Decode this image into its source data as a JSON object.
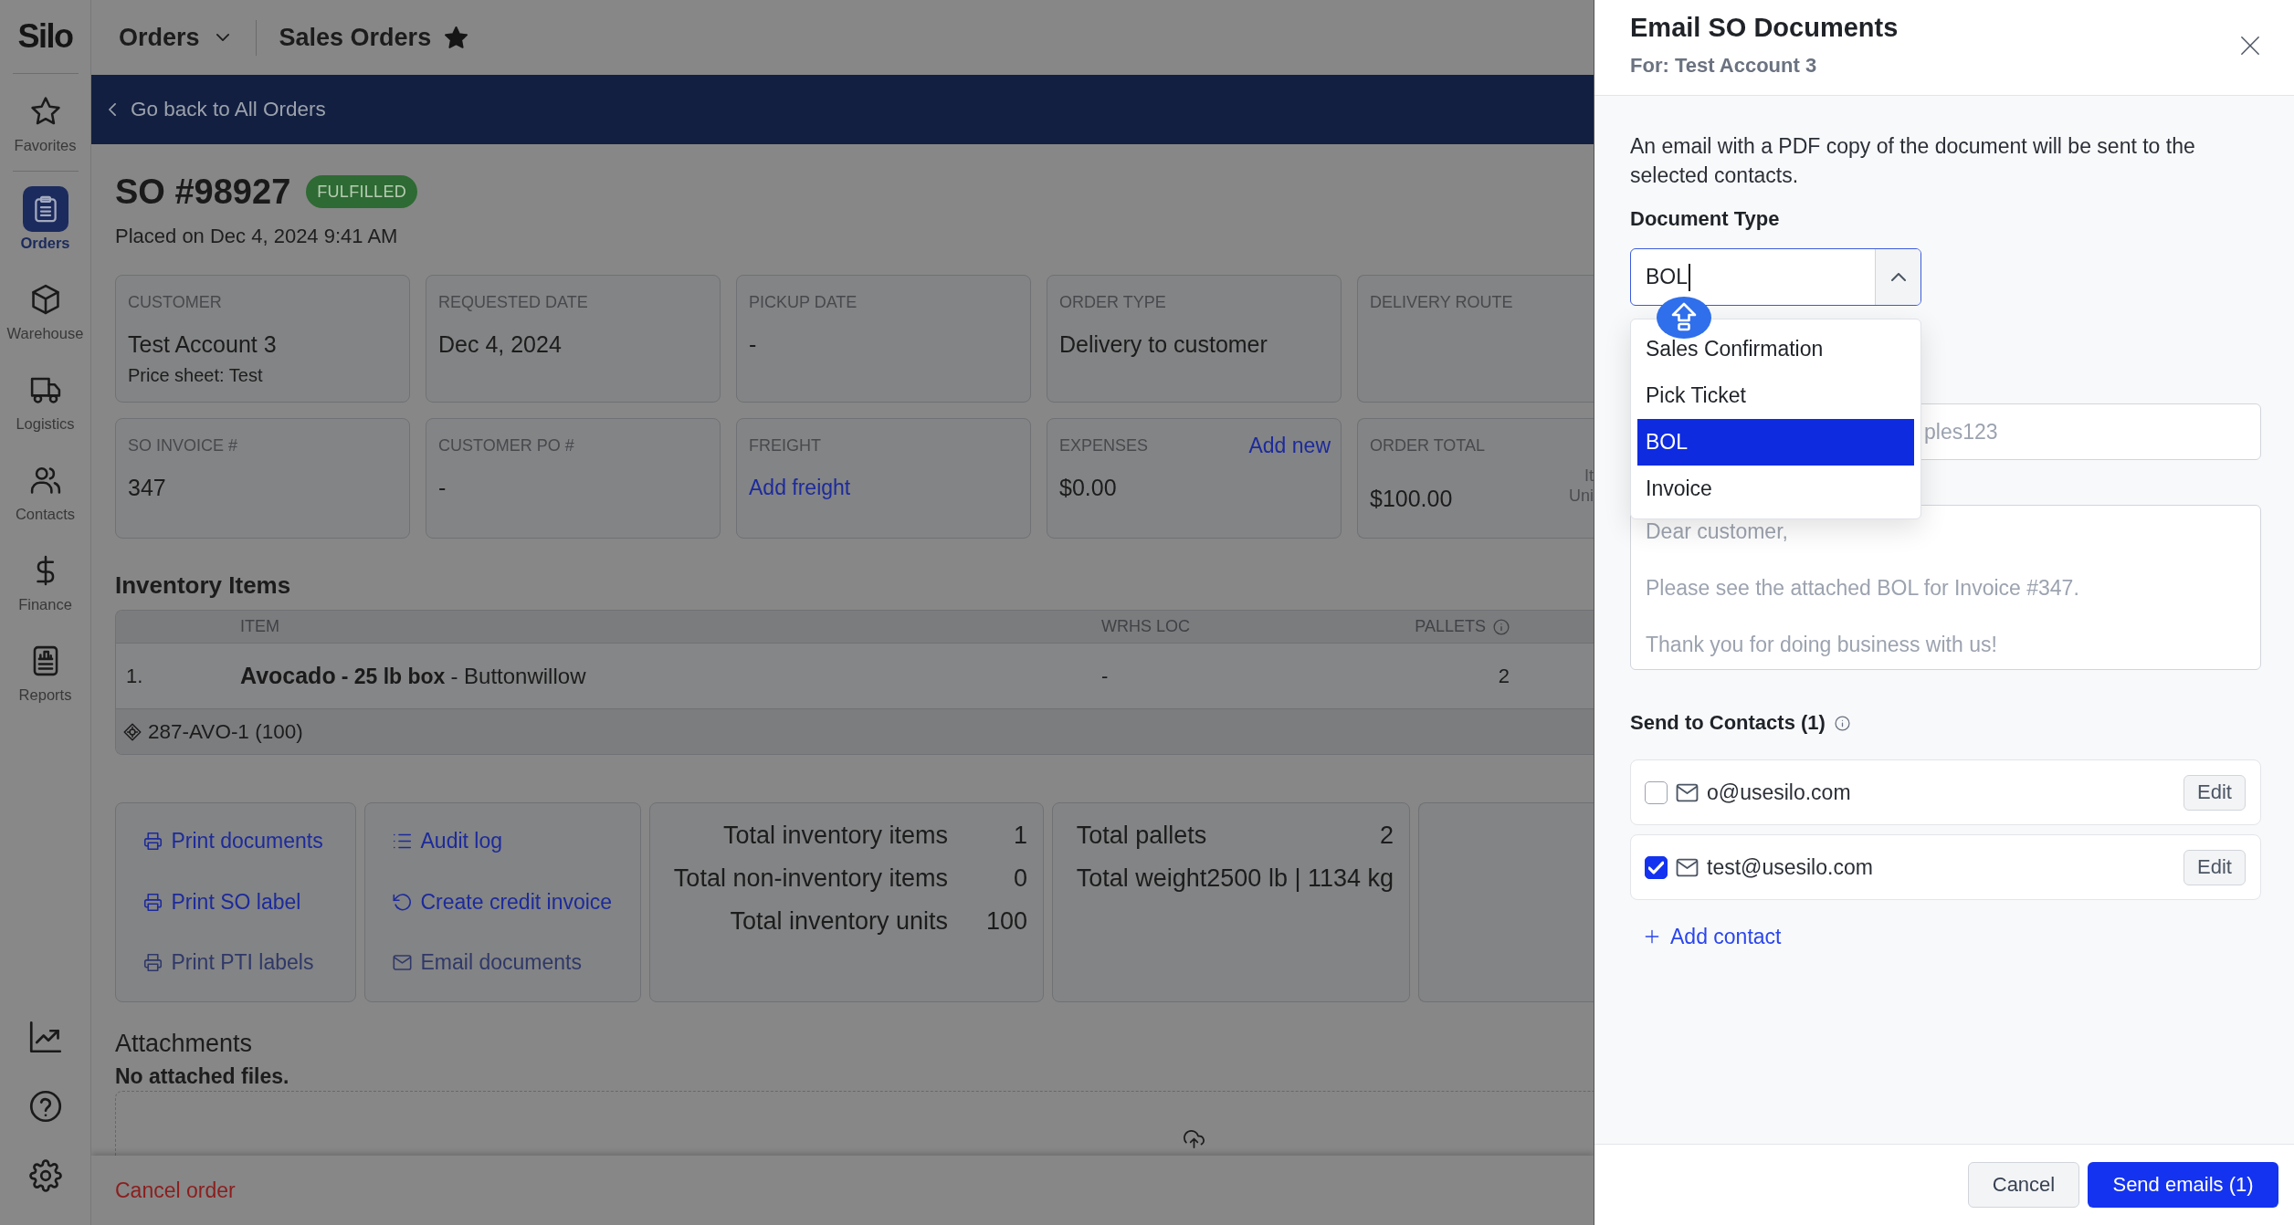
{
  "sidebar": {
    "logo": "Silo",
    "items": [
      {
        "label": "Favorites",
        "selected": false
      },
      {
        "label": "Orders",
        "selected": true
      },
      {
        "label": "Warehouse",
        "selected": false
      },
      {
        "label": "Logistics",
        "selected": false
      },
      {
        "label": "Contacts",
        "selected": false
      },
      {
        "label": "Finance",
        "selected": false
      },
      {
        "label": "Reports",
        "selected": false
      }
    ]
  },
  "header": {
    "section": "Orders",
    "page": "Sales Orders",
    "starred": true
  },
  "back_link": "Go back to All Orders",
  "order": {
    "title": "SO #98927",
    "status": "FULFILLED",
    "placed": "Placed on Dec 4, 2024 9:41 AM"
  },
  "info_cards": [
    {
      "label": "CUSTOMER",
      "value": "Test Account 3",
      "note": "Price sheet: Test"
    },
    {
      "label": "REQUESTED DATE",
      "value": "Dec 4, 2024"
    },
    {
      "label": "PICKUP DATE",
      "value": "-"
    },
    {
      "label": "ORDER TYPE",
      "value": "Delivery to customer"
    },
    {
      "label": "DELIVERY ROUTE"
    },
    {
      "label": "SO INVOICE #",
      "value": "347"
    },
    {
      "label": "CUSTOMER PO #",
      "value": "-"
    },
    {
      "label": "FREIGHT",
      "link": "Add freight"
    },
    {
      "label": "EXPENSES",
      "action": "Add new",
      "value": "$0.00"
    },
    {
      "label": "ORDER TOTAL",
      "value": "$100.00",
      "side_lines": [
        "It",
        "Uni"
      ]
    }
  ],
  "inventory": {
    "title": "Inventory Items",
    "columns": [
      {
        "label": "ITEM",
        "info": false
      },
      {
        "label": "WRHS LOC",
        "info": false
      },
      {
        "label": "PALLETS",
        "info": true
      }
    ],
    "rows": [
      {
        "number": "1.",
        "name": "Avocado",
        "package": "- 25 lb box",
        "origin": "- Buttonwillow",
        "wrhs_loc": "-",
        "pallets": "2",
        "lot": "287-AVO-1 (100)"
      }
    ]
  },
  "action_groups": [
    {
      "actions": [
        {
          "label": "Print documents",
          "disabled": false
        },
        {
          "label": "Print SO label",
          "disabled": false
        },
        {
          "label": "Print PTI labels",
          "disabled": true
        }
      ]
    },
    {
      "actions": [
        {
          "label": "Audit log",
          "disabled": false
        },
        {
          "label": "Create credit invoice",
          "disabled": false
        },
        {
          "label": "Email documents",
          "disabled": true
        }
      ]
    }
  ],
  "totals": [
    {
      "rows": [
        {
          "label": "Total inventory items",
          "value": "1"
        },
        {
          "label": "Total non-inventory items",
          "value": "0"
        },
        {
          "label": "Total inventory units",
          "value": "100"
        }
      ]
    },
    {
      "rows": [
        {
          "label": "Total pallets",
          "value": "2"
        },
        {
          "label": "Total weight",
          "value": "2500 lb | 1134 kg"
        }
      ]
    }
  ],
  "attachments": {
    "title": "Attachments",
    "empty_text": "No attached files."
  },
  "cancel_order": "Cancel order",
  "email_panel": {
    "title": "Email SO Documents",
    "subtitle": "For: Test Account 3",
    "description": "An email with a PDF copy of the document will be sent to the selected contacts.",
    "document_type": {
      "label": "Document Type",
      "value": "BOL",
      "expanded": true,
      "options": [
        {
          "label": "Sales Confirmation",
          "selected": false
        },
        {
          "label": "Pick Ticket",
          "selected": false
        },
        {
          "label": "BOL",
          "selected": true
        },
        {
          "label": "Invoice",
          "selected": false
        }
      ]
    },
    "partly_hidden_field": {
      "placeholder": "ples123"
    },
    "message": {
      "placeholder": "Dear customer,\n\nPlease see the attached BOL for Invoice #347.\n\nThank you for doing business with us!"
    },
    "contacts": {
      "title": "Send to Contacts (1)",
      "items": [
        {
          "email": "o@usesilo.com",
          "checked": false,
          "edit": "Edit"
        },
        {
          "email": "test@usesilo.com",
          "checked": true,
          "edit": "Edit"
        }
      ],
      "add_label": "Add contact"
    },
    "cancel": "Cancel",
    "send": "Send emails (1)"
  }
}
